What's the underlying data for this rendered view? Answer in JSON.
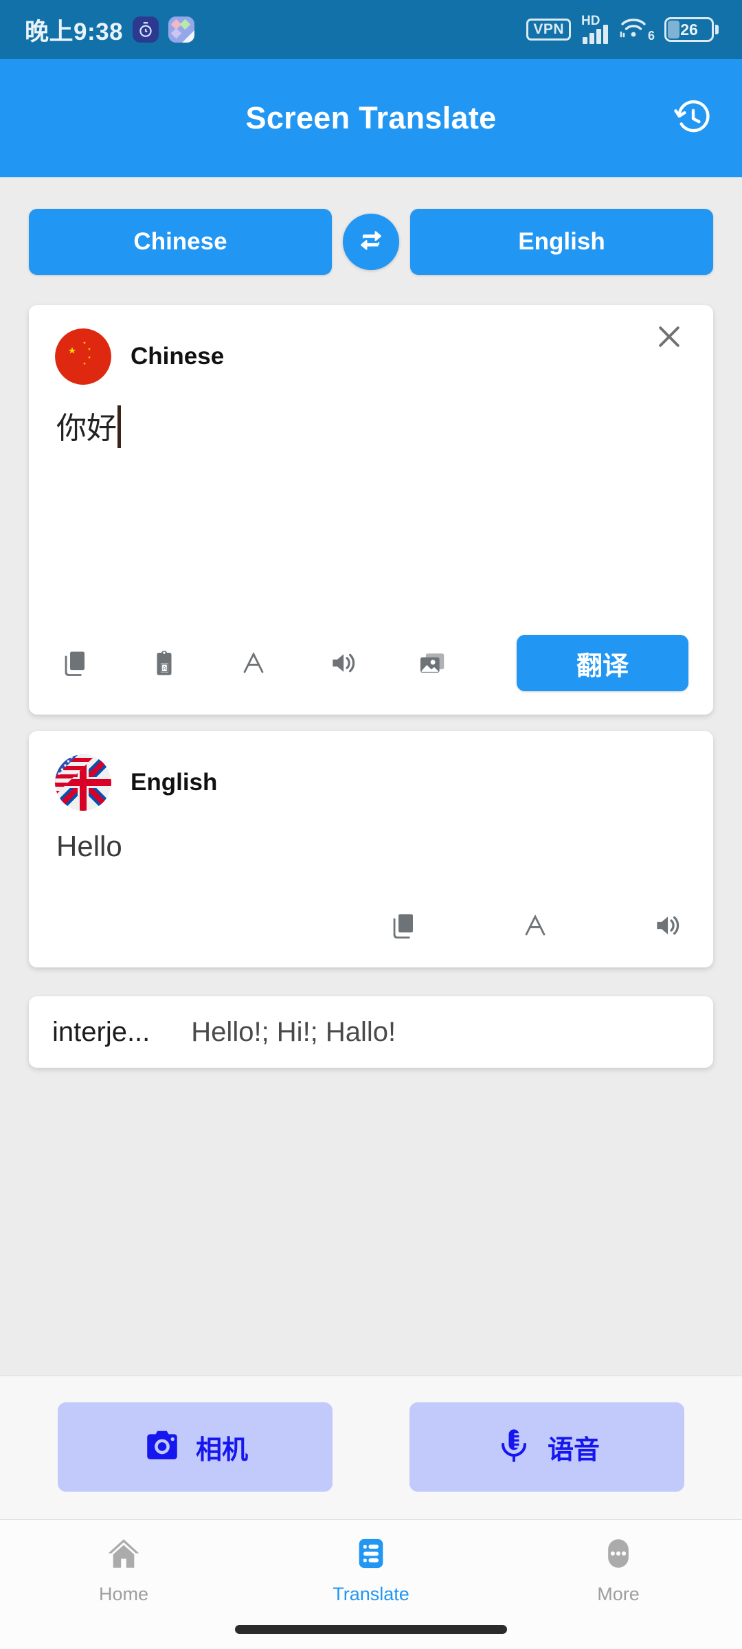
{
  "status_bar": {
    "time": "晚上9:38",
    "app_icons": [
      "stopwatch-app-icon",
      "diamond-app-icon"
    ],
    "vpn_label": "VPN",
    "network_label": "HD",
    "signal_bars": 4,
    "wifi_generation": "6",
    "battery_percent": "26",
    "battery_level": 26
  },
  "app_bar": {
    "title": "Screen Translate",
    "history_icon": "history-icon"
  },
  "language_selector": {
    "source_language": "Chinese",
    "target_language": "English",
    "swap_icon": "swap-horizontal-icon"
  },
  "source_card": {
    "flag": "china-flag-icon",
    "language": "Chinese",
    "close_icon": "close-icon",
    "input_value": "你好",
    "input_placeholder": "",
    "tools": [
      {
        "name": "copy-icon",
        "label": "Copy"
      },
      {
        "name": "paste-icon",
        "label": "Paste"
      },
      {
        "name": "font-size-icon",
        "label": "Text size"
      },
      {
        "name": "speaker-icon",
        "label": "Listen"
      },
      {
        "name": "image-icon",
        "label": "Image"
      }
    ],
    "translate_label": "翻译"
  },
  "target_card": {
    "flag": "english-flag-icon",
    "language": "English",
    "translated_text": "Hello",
    "tools": [
      {
        "name": "copy-icon",
        "label": "Copy"
      },
      {
        "name": "font-size-icon",
        "label": "Text size"
      },
      {
        "name": "speaker-icon",
        "label": "Listen"
      }
    ]
  },
  "definition": {
    "part_of_speech": "interje...",
    "meanings": "Hello!; Hi!; Hallo!"
  },
  "quick_actions": [
    {
      "icon": "camera-icon",
      "label": "相机"
    },
    {
      "icon": "microphone-icon",
      "label": "语音"
    }
  ],
  "bottom_nav": {
    "active": "Translate",
    "items": [
      {
        "icon": "home-icon",
        "label": "Home"
      },
      {
        "icon": "translate-list-icon",
        "label": "Translate"
      },
      {
        "icon": "more-dots-icon",
        "label": "More"
      }
    ]
  },
  "colors": {
    "status_bar": "#1271A8",
    "accent_blue": "#2196F3",
    "page_background": "#ECECEC",
    "card_background": "#FFFFFF",
    "action_background": "#C2C9FB",
    "action_foreground": "#1616EE",
    "icon_grey": "#6E7377",
    "nav_inactive": "#9E9E9E"
  }
}
